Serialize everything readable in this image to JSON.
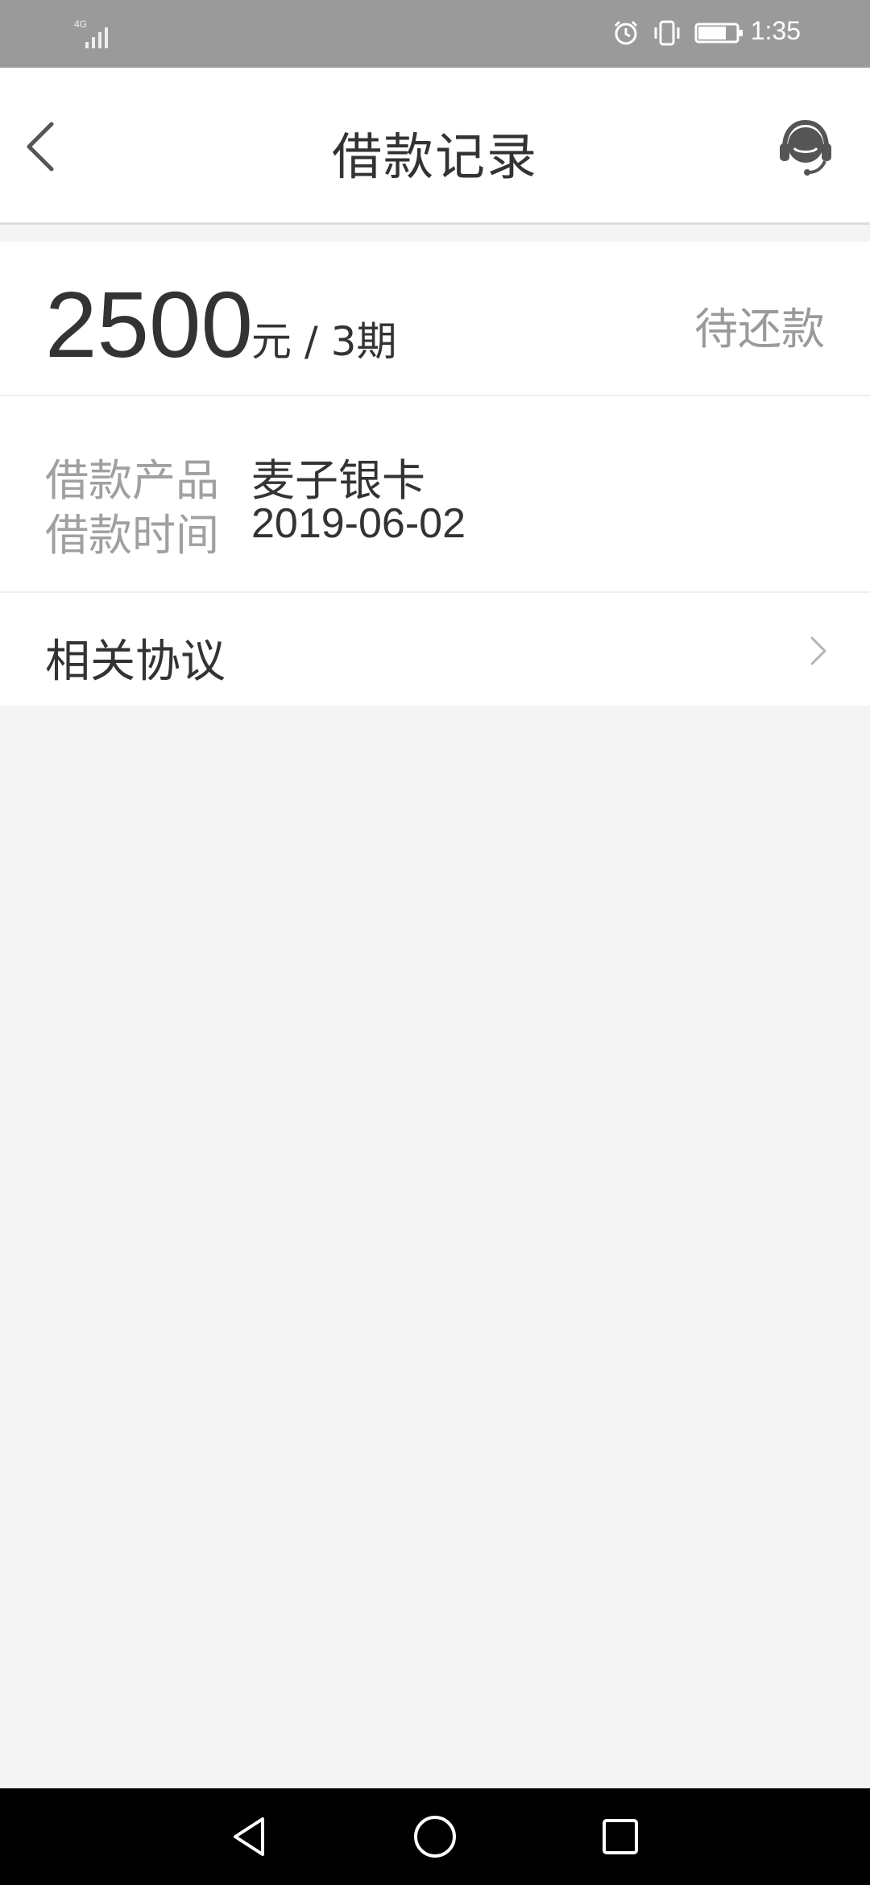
{
  "status_bar": {
    "network": "4G",
    "time": "1:35",
    "icons": [
      "signal-icon",
      "alarm-icon",
      "vibrate-icon",
      "battery-icon"
    ]
  },
  "header": {
    "title": "借款记录",
    "back_icon": "chevron-left-icon",
    "service_icon": "customer-service-icon"
  },
  "loan": {
    "amount": "2500",
    "unit_period": "元 / 3期",
    "status": "待还款"
  },
  "details": [
    {
      "label": "借款产品",
      "value": "麦子银卡"
    },
    {
      "label": "借款时间",
      "value": "2019-06-02"
    }
  ],
  "agreement": {
    "label": "相关协议"
  },
  "nav_bar": {
    "buttons": [
      "back-triangle-icon",
      "home-circle-icon",
      "recents-square-icon"
    ]
  },
  "colors": {
    "status_bar_bg": "#9a9a9a",
    "page_bg": "#f4f4f4",
    "card_bg": "#ffffff",
    "muted_text": "#9a9a9a",
    "primary_text": "#333333"
  }
}
